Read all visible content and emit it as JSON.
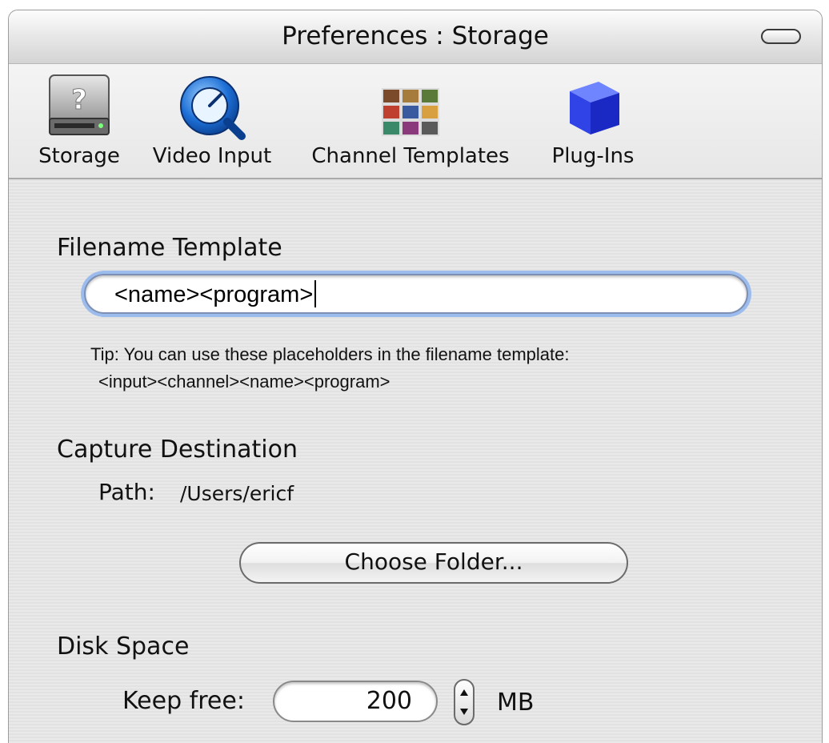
{
  "window": {
    "title": "Preferences : Storage"
  },
  "toolbar": {
    "items": [
      {
        "label": "Storage",
        "icon": "hard-disk-icon"
      },
      {
        "label": "Video Input",
        "icon": "quicktime-icon"
      },
      {
        "label": "Channel Templates",
        "icon": "thumbnail-grid-icon"
      },
      {
        "label": "Plug-Ins",
        "icon": "blue-cube-icon"
      }
    ]
  },
  "filename_template": {
    "heading": "Filename Template",
    "value": "<name><program>",
    "tip_line1": "Tip: You can use these placeholders in the filename template:",
    "tip_line2": "<input><channel><name><program>"
  },
  "capture_destination": {
    "heading": "Capture Destination",
    "path_label": "Path:",
    "path_value": "/Users/ericf",
    "choose_button": "Choose Folder..."
  },
  "disk_space": {
    "heading": "Disk Space",
    "keep_free_label": "Keep free:",
    "keep_free_value": "200",
    "unit": "MB"
  },
  "colors": {
    "focus_ring": "#9bbcec",
    "plugin_cube": "#2233ee",
    "quicktime_blue": "#1d6fd6"
  }
}
